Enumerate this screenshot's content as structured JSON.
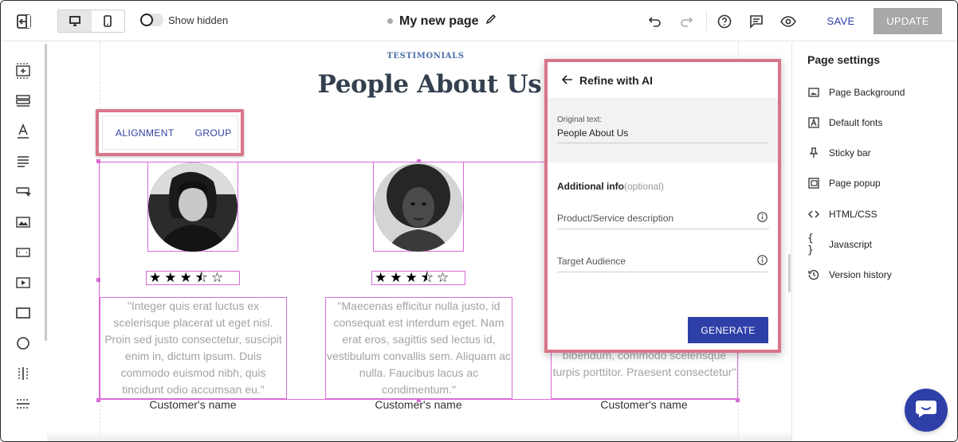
{
  "topbar": {
    "show_hidden_label": "Show hidden",
    "page_name": "My new page",
    "save_label": "SAVE",
    "update_label": "UPDATE",
    "icons": [
      "exit-editor-icon",
      "desktop-icon",
      "mobile-icon",
      "undo-icon",
      "redo-icon",
      "help-icon",
      "comments-icon",
      "preview-icon",
      "edit-pencil-icon"
    ]
  },
  "left_toolbar": {
    "tools": [
      "add-section-icon",
      "rows-icon",
      "text-icon",
      "paragraph-icon",
      "button-icon",
      "image-icon",
      "form-field-icon",
      "video-icon",
      "box-icon",
      "circle-icon",
      "columns-icon",
      "divider-icon"
    ]
  },
  "canvas": {
    "eyebrow": "TESTIMONIALS",
    "title": "People About Us",
    "element_toolbar": {
      "alignment_label": "ALIGNMENT",
      "group_label": "GROUP"
    },
    "testimonials": [
      {
        "rating": 3.5,
        "stars_text": "★★★⯪☆",
        "quote": "\"Integer quis erat luctus ex scelerisque placerat ut eget nisl. Proin sed justo consectetur, suscipit enim in, dictum ipsum. Duis commodo euismod nibh, quis tincidunt odio accumsan eu.\"",
        "name": "Customer's name"
      },
      {
        "rating": 3.5,
        "stars_text": "★★★⯪☆",
        "quote": "\"Maecenas efficitur nulla justo, id consequat est interdum eget. Nam erat eros, sagittis sed lectus id, vestibulum convallis sem. Aliquam ac nulla. Faucibus lacus ac condimentum.\"",
        "name": "Customer's name"
      },
      {
        "quote_visible": "bibendum, commodo scelerisque turpis porttitor. Praesent consectetur\"",
        "name": "Customer's name"
      }
    ]
  },
  "ai_panel": {
    "title": "Refine with AI",
    "original_label": "Original text:",
    "original_value": "People About Us",
    "additional_label": "Additional info",
    "optional_label": "(optional)",
    "fields": [
      {
        "placeholder": "Product/Service description"
      },
      {
        "placeholder": "Target Audience"
      }
    ],
    "generate_label": "GENERATE"
  },
  "page_settings": {
    "title": "Page settings",
    "items": [
      {
        "label": "Page Background",
        "icon": "image-icon"
      },
      {
        "label": "Default fonts",
        "icon": "font-icon"
      },
      {
        "label": "Sticky bar",
        "icon": "pin-icon"
      },
      {
        "label": "Page popup",
        "icon": "popup-icon"
      },
      {
        "label": "HTML/CSS",
        "icon": "code-icon"
      },
      {
        "label": "Javascript",
        "icon": "braces-icon"
      },
      {
        "label": "Version history",
        "icon": "history-icon"
      }
    ]
  },
  "colors": {
    "accent": "#2e3fa8",
    "selection": "#d86bd5",
    "highlight": "#d9758a",
    "title": "#34404f"
  }
}
